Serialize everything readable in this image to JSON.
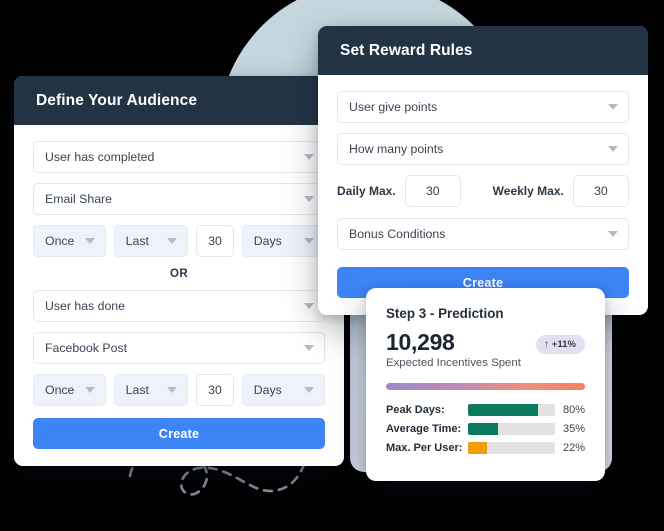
{
  "audience": {
    "title": "Define Your Audience",
    "condition_1": {
      "action": "User has completed",
      "event": "Email Share",
      "frequency": "Once",
      "range": "Last",
      "amount": "30",
      "unit": "Days"
    },
    "divider": "OR",
    "condition_2": {
      "action": "User has done",
      "event": "Facebook Post",
      "frequency": "Once",
      "range": "Last",
      "amount": "30",
      "unit": "Days"
    },
    "create_label": "Create"
  },
  "reward": {
    "title": "Set Reward Rules",
    "rule_type": "User give points",
    "points": "How many points",
    "daily_max_label": "Daily Max.",
    "daily_max_value": "30",
    "weekly_max_label": "Weekly Max.",
    "weekly_max_value": "30",
    "bonus": "Bonus Conditions",
    "create_label": "Create"
  },
  "prediction": {
    "title": "Step 3 - Prediction",
    "value": "10,298",
    "caption": "Expected Incentives Spent",
    "badge": "↑ +11%",
    "metrics": [
      {
        "label": "Peak Days:",
        "percent": "80%",
        "value": 80,
        "color": "#0a7a5e"
      },
      {
        "label": "Average Time:",
        "percent": "35%",
        "value": 35,
        "color": "#0a7a5e"
      },
      {
        "label": "Max. Per User:",
        "percent": "22%",
        "value": 22,
        "color": "#f59b09"
      }
    ]
  },
  "colors": {
    "header": "#223444",
    "accent": "#3d85f7",
    "green": "#0a7a5e",
    "orange": "#f59b09",
    "badge_bg": "#e3dff1"
  }
}
